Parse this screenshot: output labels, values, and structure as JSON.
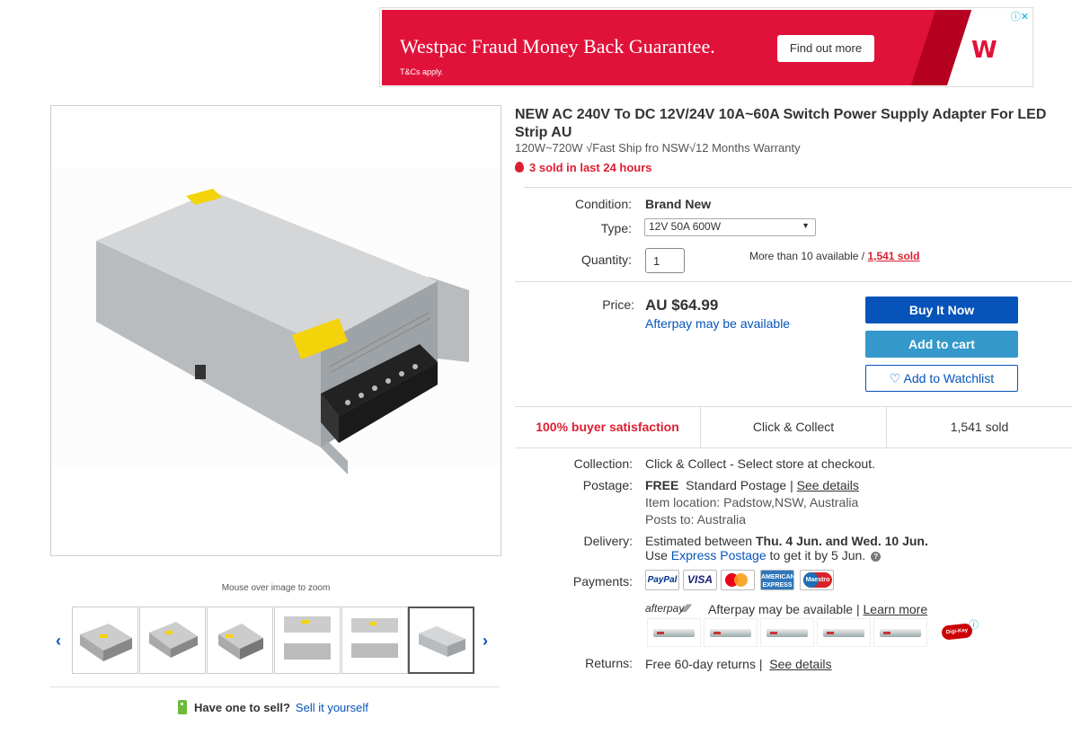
{
  "ad": {
    "headline": "Westpac Fraud Money Back Guarantee.",
    "tc": "T&Cs apply.",
    "cta": "Find out more",
    "info_icons": "ⓘ✕"
  },
  "gallery": {
    "hint": "Mouse over image to zoom",
    "prev_icon": "‹",
    "next_icon": "›",
    "thumb_count": 6,
    "active_thumb": 6
  },
  "sell": {
    "question": "Have one to sell?",
    "link": "Sell it yourself"
  },
  "listing": {
    "title": "NEW AC 240V To DC 12V/24V 10A~60A Switch Power Supply Adapter For LED Strip AU",
    "subtitle": "120W~720W √Fast Ship fro NSW√12 Months Warranty",
    "sold_recent": "3 sold in last 24 hours"
  },
  "details": {
    "condition_label": "Condition:",
    "condition_value": "Brand New",
    "type_label": "Type:",
    "type_value": "12V 50A 600W",
    "quantity_label": "Quantity:",
    "quantity_value": "1",
    "available_text": "More than 10 available /",
    "sold_link": "1,541 sold"
  },
  "pricing": {
    "price_label": "Price:",
    "price_value": "AU $64.99",
    "afterpay_link": "Afterpay may be available",
    "buy_now": "Buy It Now",
    "add_to_cart": "Add to cart",
    "watchlist": "Add to Watchlist",
    "watchlist_icon": "♡"
  },
  "stats": {
    "satisfaction": "100% buyer satisfaction",
    "click_collect": "Click & Collect",
    "sold": "1,541 sold"
  },
  "shipping": {
    "collection_label": "Collection:",
    "collection_value": "Click & Collect - Select store at checkout.",
    "postage_label": "Postage:",
    "postage_free": "FREE",
    "postage_type": "Standard Postage |",
    "postage_details": "See details",
    "item_location": "Item location:  Padstow,NSW, Australia",
    "posts_to": "Posts to:  Australia",
    "delivery_label": "Delivery:",
    "delivery_prefix": "Estimated between",
    "delivery_dates": "Thu. 4 Jun. and Wed. 10 Jun.",
    "express_prefix": "Use",
    "express_link": "Express Postage",
    "express_suffix": "to get it by 5 Jun.",
    "payments_label": "Payments:",
    "payment_methods": [
      "PayPal",
      "VISA",
      "Mastercard",
      "American Express",
      "Maestro"
    ],
    "afterpay_logo": "afterpay⁄⁄⁄",
    "afterpay_text": "Afterpay may be available  |",
    "afterpay_learn": "Learn more",
    "returns_label": "Returns:",
    "returns_value": "Free 60-day returns |",
    "returns_details": "See details",
    "digikey": "Digi-Key",
    "ad_info": "ⓘ"
  }
}
